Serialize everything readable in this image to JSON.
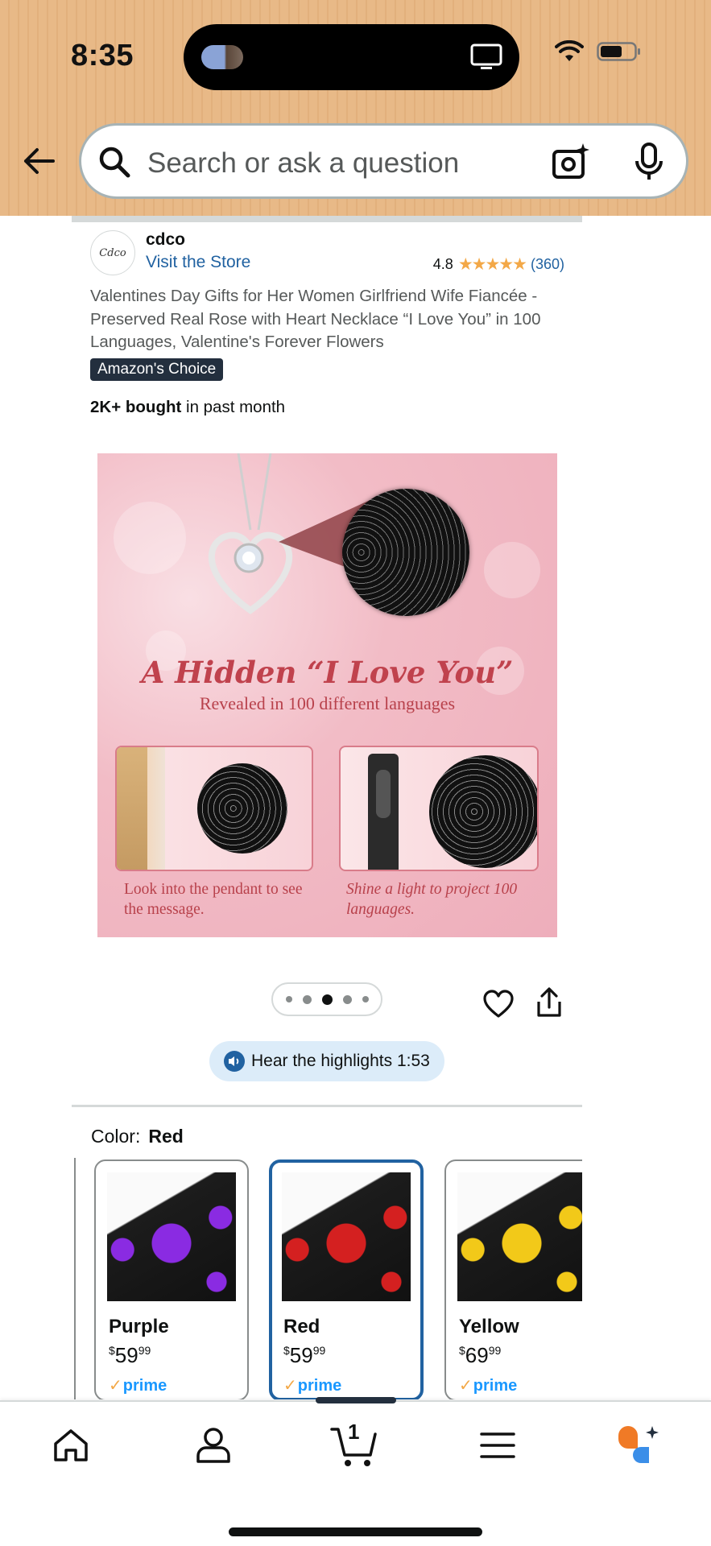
{
  "status_bar": {
    "time": "8:35"
  },
  "search": {
    "placeholder": "Search or ask a question"
  },
  "store": {
    "name": "cdco",
    "logo_text": "Cdco",
    "visit_label": "Visit the Store",
    "rating": "4.8",
    "stars": "★★★★★",
    "rating_count": "(360)"
  },
  "product": {
    "title": "Valentines Day Gifts for Her Women Girlfriend Wife Fiancée - Preserved Real Rose with Heart Necklace “I Love You” in 100 Languages, Valentine's Forever Flowers",
    "badge": "Amazon's Choice",
    "bought_count": "2K+ bought",
    "bought_suffix": " in past month"
  },
  "product_image": {
    "headline": "A Hidden “I Love You”",
    "subheadline": "Revealed in 100 different languages",
    "caption_left": "Look into the pendant to see the message.",
    "caption_right": "Shine a light to project 100 languages."
  },
  "carousel": {
    "active_index": 2,
    "dots": 5
  },
  "highlights": {
    "label": "Hear the highlights 1:53"
  },
  "color": {
    "label": "Color:",
    "selected": "Red",
    "options": [
      {
        "name": "Purple",
        "price_whole": "59",
        "price_cents": "99",
        "currency": "$",
        "prime": "prime",
        "rose_color": "#8a2be2"
      },
      {
        "name": "Red",
        "price_whole": "59",
        "price_cents": "99",
        "currency": "$",
        "prime": "prime",
        "rose_color": "#d42020"
      },
      {
        "name": "Yellow",
        "price_whole": "69",
        "price_cents": "99",
        "currency": "$",
        "prime": "prime",
        "rose_color": "#f2c919"
      }
    ]
  },
  "bottom_nav": {
    "items": [
      "home-icon",
      "account-icon",
      "cart-icon",
      "menu-icon",
      "rufus-icon"
    ],
    "cart_count": "1"
  },
  "colors": {
    "accent_link": "#2162a1",
    "star": "#f3a847",
    "prime_blue": "#1a98ff",
    "header_bg": "#e8b987",
    "badge_bg": "#232f3e"
  }
}
